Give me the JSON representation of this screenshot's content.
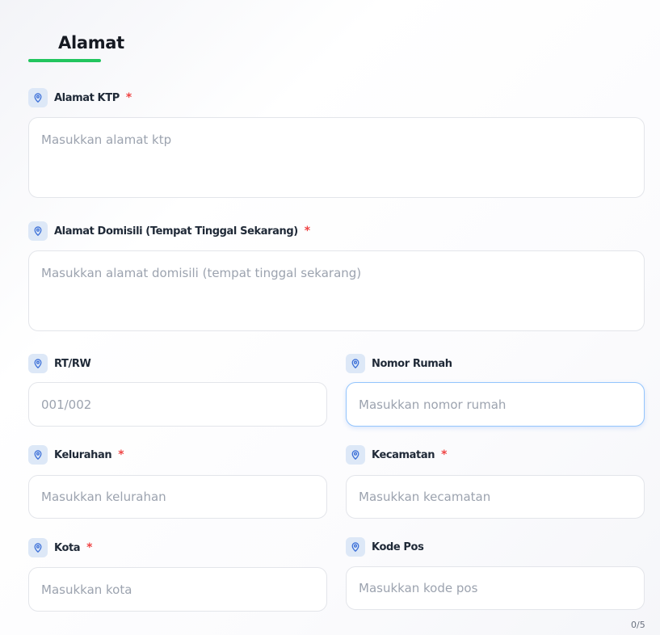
{
  "section": {
    "title": "Alamat",
    "accent_color": "#22c55e"
  },
  "required_marker": "*",
  "fields": {
    "alamat_ktp": {
      "icon": "map-pin-icon",
      "label": "Alamat KTP",
      "required": true,
      "placeholder": "Masukkan alamat ktp",
      "value": ""
    },
    "alamat_domisili": {
      "icon": "map-pin-icon",
      "label": "Alamat Domisili (Tempat Tinggal Sekarang)",
      "required": true,
      "placeholder": "Masukkan alamat domisili (tempat tinggal sekarang)",
      "value": ""
    },
    "rt_rw": {
      "icon": "map-pin-icon",
      "label": "RT/RW",
      "required": false,
      "placeholder": "001/002",
      "value": ""
    },
    "nomor_rumah": {
      "icon": "map-pin-icon",
      "label": "Nomor Rumah",
      "required": false,
      "placeholder": "Masukkan nomor rumah",
      "value": "",
      "focused": true
    },
    "kelurahan": {
      "icon": "map-pin-icon",
      "label": "Kelurahan",
      "required": true,
      "placeholder": "Masukkan kelurahan",
      "value": ""
    },
    "kecamatan": {
      "icon": "map-pin-icon",
      "label": "Kecamatan",
      "required": true,
      "placeholder": "Masukkan kecamatan",
      "value": ""
    },
    "kota": {
      "icon": "map-pin-icon",
      "label": "Kota",
      "required": true,
      "placeholder": "Masukkan kota",
      "value": ""
    },
    "kode_pos": {
      "icon": "map-pin-icon",
      "label": "Kode Pos",
      "required": false,
      "placeholder": "Masukkan kode pos",
      "value": "",
      "counter": "0/5"
    }
  },
  "colors": {
    "required": "#ef4444",
    "icon": "#3b6fd8",
    "icon_badge": "#dde8f7",
    "focus_border": "#93c5fd"
  }
}
